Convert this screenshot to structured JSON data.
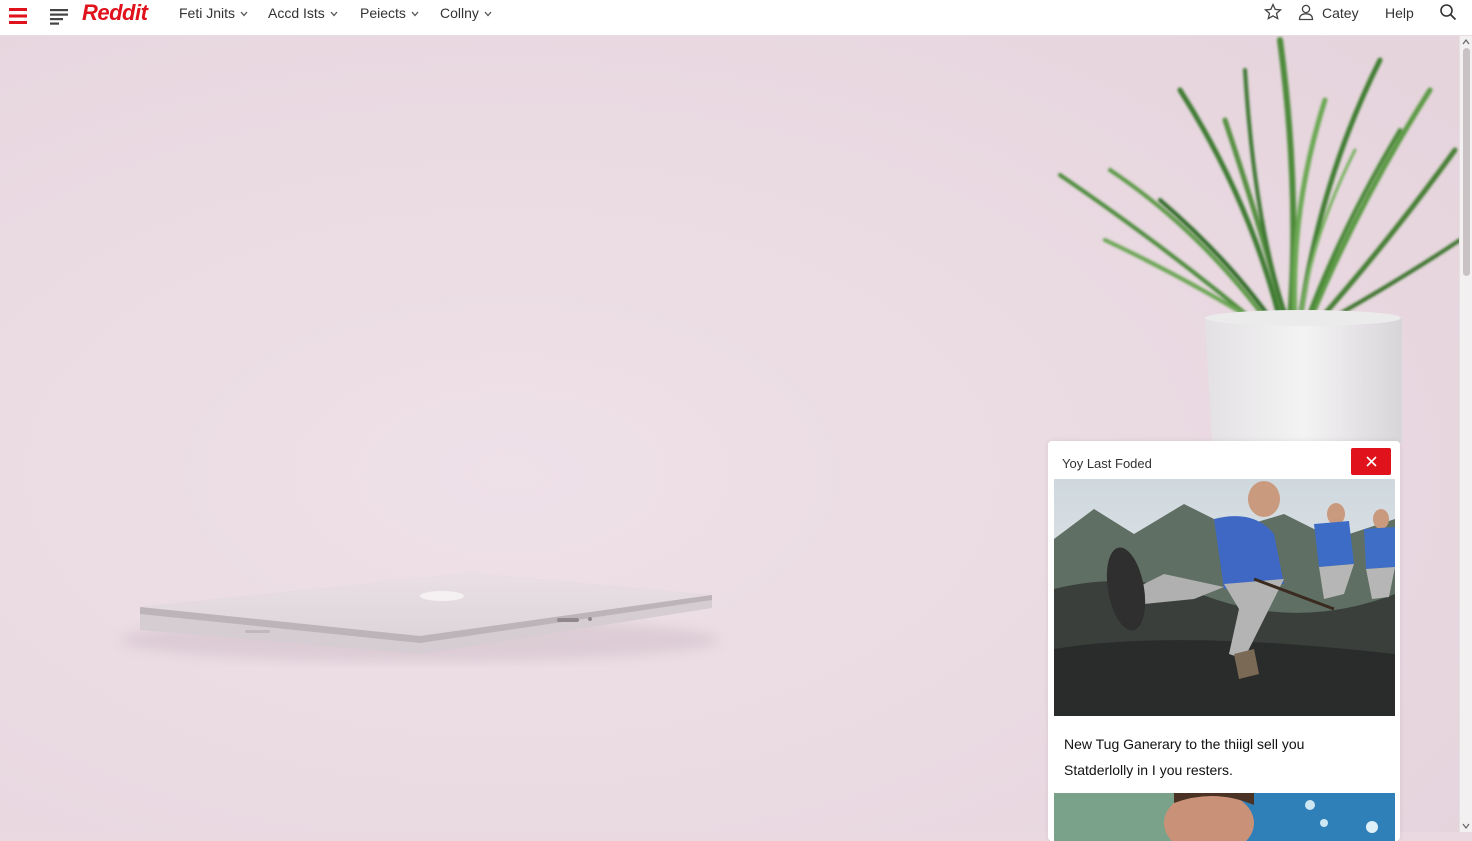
{
  "header": {
    "logo": "Reddit",
    "nav": [
      {
        "label": "Feti Jnits"
      },
      {
        "label": "Accd Ists"
      },
      {
        "label": "Peiects"
      },
      {
        "label": "Collny"
      }
    ],
    "user_label": "Catey",
    "help_label": "Help"
  },
  "card": {
    "title": "Yoy Last Foded",
    "headline_line1": "New Tug Ganerary to the thiigl sell you",
    "headline_line2": "Statderlolly in I you resters."
  },
  "colors": {
    "brand": "#e0121c",
    "background": "#ead9e1"
  },
  "icons": [
    "menu-icon",
    "list-icon",
    "chevron-down-icon",
    "star-icon",
    "user-icon",
    "search-icon",
    "close-icon"
  ]
}
